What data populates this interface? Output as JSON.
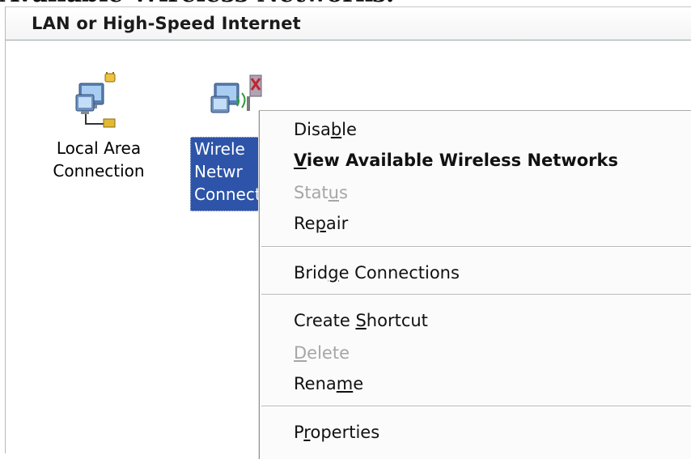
{
  "document": {
    "cropped_heading": "Available Wireless Networks."
  },
  "group": {
    "title": "LAN or High-Speed Internet"
  },
  "items": [
    {
      "label": "Local Area\nConnection",
      "icon": "lan-connection-icon"
    },
    {
      "label": "Wirele\nNetwr\nConnect",
      "icon": "wireless-connection-icon"
    }
  ],
  "context_menu": {
    "disable": {
      "pre": "Disa",
      "key": "b",
      "post": "le"
    },
    "view_wireless": {
      "pre": "",
      "key": "V",
      "post": "iew Available Wireless Networks"
    },
    "status": {
      "pre": "Stat",
      "key": "u",
      "post": "s"
    },
    "repair": {
      "pre": "Re",
      "key": "p",
      "post": "air"
    },
    "bridge": {
      "pre": "Brid",
      "key": "g",
      "post": "e Connections"
    },
    "create_shortcut": {
      "pre": "Create ",
      "key": "S",
      "post": "hortcut"
    },
    "delete": {
      "pre": "",
      "key": "D",
      "post": "elete"
    },
    "rename": {
      "pre": "Rena",
      "key": "m",
      "post": "e"
    },
    "properties": {
      "pre": "P",
      "key": "r",
      "post": "operties"
    }
  },
  "colors": {
    "selection": "#2d54a8",
    "disabled_text": "#a6a6a6"
  }
}
